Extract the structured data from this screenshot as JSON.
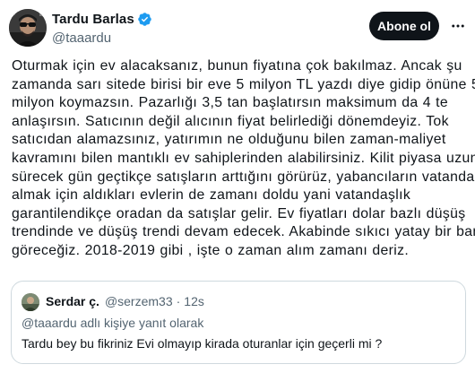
{
  "author": {
    "display_name": "Tardu Barlas",
    "handle": "@taaardu",
    "verified": true,
    "avatar_icon": "user-avatar-photo"
  },
  "actions": {
    "follow_label": "Abone ol",
    "more_icon": "more-horizontal-icon"
  },
  "tweet": {
    "lines": [
      "Oturmak için ev alacaksanız, bunun fiyatına çok bakılmaz. Ancak şu",
      "zamanda sarı sitede birisi bir eve 5 milyon TL yazdı diye gidip önüne 5",
      "milyon koymazsın. Pazarlığı 3,5 tan başlatırsın maksimum da 4 te",
      "anlaşırsın. Satıcının değil alıcının fiyat belirlediği dönemdeyiz. Tok",
      "satıcıdan alamazsınız, yatırımın ne olduğunu bilen zaman-maliyet",
      "kavramını bilen mantıklı ev sahiplerinden alabilirsiniz. Kilit piyasa uzun",
      "sürecek gün geçtikçe satışların arttığını görürüz, yabancıların vatandaşlık",
      "almak için aldıkları evlerin de zamanı doldu yani vatandaşlık",
      "garantilendikçe oradan da satışlar gelir. Ev fiyatları dolar bazlı düşüş",
      "trendinde ve düşüş trendi devam edecek. Akabinde sıkıcı yatay bir bant",
      "göreceğiz. 2018-2019 gibi , işte o zaman alım zamanı deriz."
    ]
  },
  "quote": {
    "display_name": "Serdar ç.",
    "handle": "@serzem33",
    "separator": "·",
    "time": "12s",
    "reply_to": "@taaardu adlı kişiye yanıt olarak",
    "text": "Tardu bey bu fikriniz Evi olmayıp kirada oturanlar için geçerli mi ?"
  },
  "colors": {
    "text_primary": "#0f1419",
    "text_secondary": "#536471",
    "verified_blue": "#1d9bf0",
    "border": "#cfd9de",
    "button_bg": "#0f1419"
  }
}
